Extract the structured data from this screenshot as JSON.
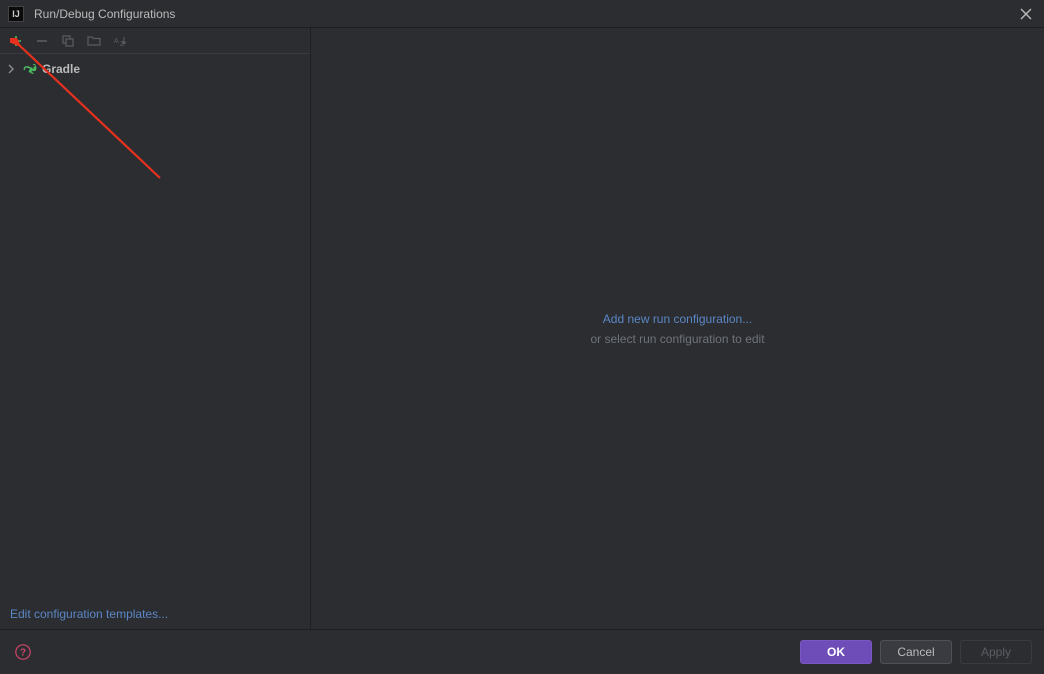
{
  "window": {
    "title": "Run/Debug Configurations"
  },
  "toolbar": {
    "add_tooltip": "Add New Configuration",
    "remove_tooltip": "Remove Configuration",
    "copy_tooltip": "Copy Configuration",
    "folder_tooltip": "Create Folder",
    "sort_tooltip": "Sort Alphabetically"
  },
  "tree": {
    "items": [
      {
        "label": "Gradle",
        "icon": "gradle-icon"
      }
    ]
  },
  "sidebar": {
    "edit_templates": "Edit configuration templates..."
  },
  "content": {
    "add_link": "Add new run configuration...",
    "subtext": "or select run configuration to edit"
  },
  "footer": {
    "ok": "OK",
    "cancel": "Cancel",
    "apply": "Apply"
  },
  "colors": {
    "accent": "#6f4db8",
    "link": "#5c87c7",
    "add_green": "#4dbb5f",
    "help_pink": "#d1456b"
  }
}
